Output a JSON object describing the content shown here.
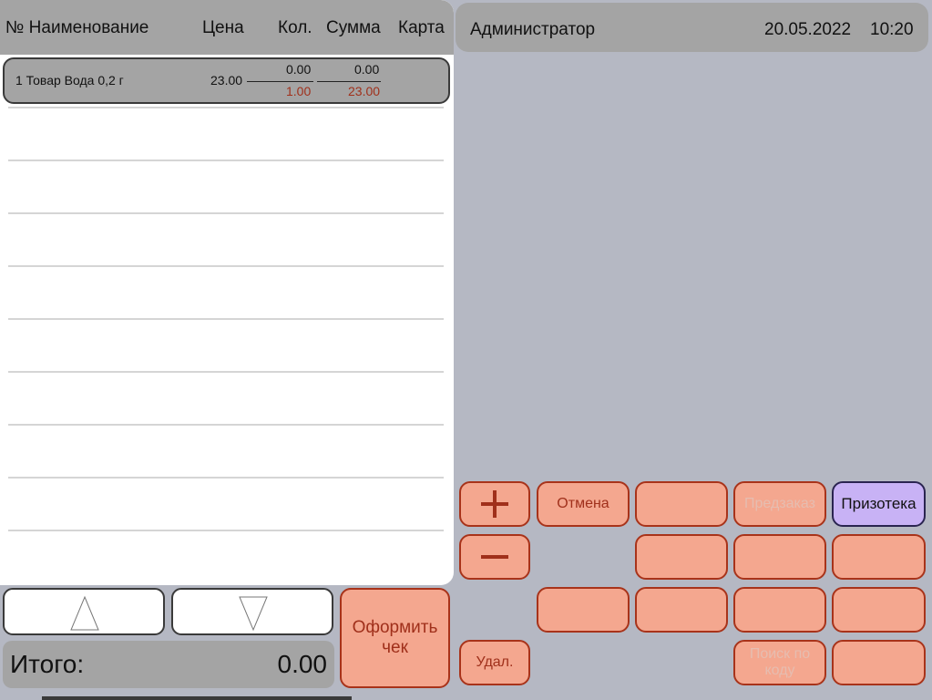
{
  "order_table": {
    "headers": {
      "number_name": "№ Наименование",
      "price": "Цена",
      "qty": "Кол.",
      "sum": "Сумма",
      "card": "Карта"
    },
    "rows": [
      {
        "name": "1 Товар Вода 0,2 г",
        "price": "23.00",
        "qty_top": "0.00",
        "qty_bottom": "1.00",
        "sum_top": "0.00",
        "sum_bottom": "23.00"
      }
    ]
  },
  "navigation": {
    "up_icon": "triangle-up-icon",
    "down_icon": "triangle-down-icon"
  },
  "total": {
    "label": "Итого:",
    "value": "0.00"
  },
  "header": {
    "user": "Администратор",
    "date": "20.05.2022",
    "time": "10:20"
  },
  "buttons": {
    "plus_icon": "plus-icon",
    "minus_icon": "minus-icon",
    "cancel": "Отмена",
    "preorder": "Предзаказ",
    "prizoteka": "Призотека",
    "checkout": "Оформить чек",
    "delete": "Удал.",
    "search_by_code": "Поиск по коду"
  },
  "colors": {
    "button_fill": "#f4a78f",
    "button_border": "#a8331a",
    "button_text": "#a0301b",
    "accent_purple": "#c8b2f5",
    "panel_gray": "#a4a4a4",
    "background": "#b5b8c3"
  }
}
